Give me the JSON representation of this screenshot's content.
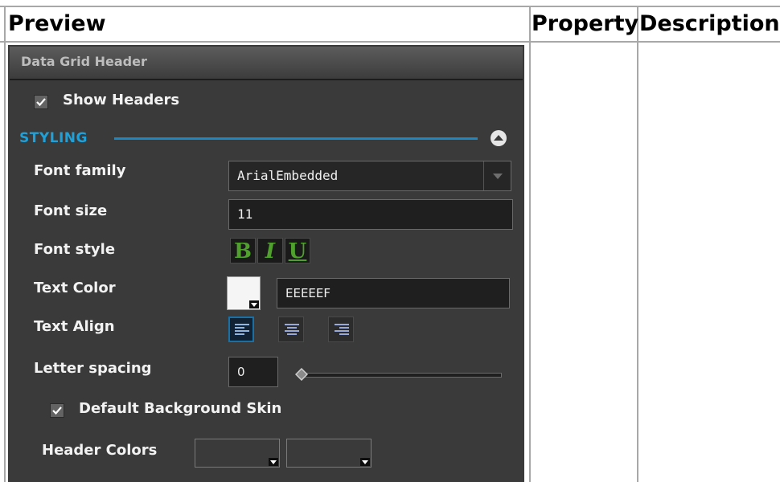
{
  "table": {
    "headers": [
      "Preview",
      "Property",
      "Description"
    ]
  },
  "panel": {
    "title": "Data Grid Header",
    "show_headers": {
      "label": "Show Headers",
      "checked": true
    },
    "styling": {
      "section_label": "STYLING",
      "font_family": {
        "label": "Font family",
        "value": "ArialEmbedded"
      },
      "font_size": {
        "label": "Font size",
        "value": "11"
      },
      "font_style": {
        "label": "Font style",
        "bold_glyph": "B",
        "italic_glyph": "I",
        "underline_glyph": "U"
      },
      "text_color": {
        "label": "Text Color",
        "value": "EEEEEF",
        "swatch": "#EEEEEF"
      },
      "text_align": {
        "label": "Text Align",
        "selected": "left",
        "options": [
          "left",
          "center",
          "right"
        ]
      },
      "letter_spacing": {
        "label": "Letter spacing",
        "value": "0",
        "slider_level": 0
      },
      "default_background_skin": {
        "label": "Default Background Skin",
        "checked": true
      },
      "header_colors": {
        "label": "Header Colors",
        "colors": [
          "#3a3a3a",
          "#3a3a3a"
        ]
      }
    }
  },
  "colors": {
    "panel_bg": "#3a3a3a",
    "accent_blue": "#1ea0d8",
    "style_green": "#4fa02d"
  }
}
